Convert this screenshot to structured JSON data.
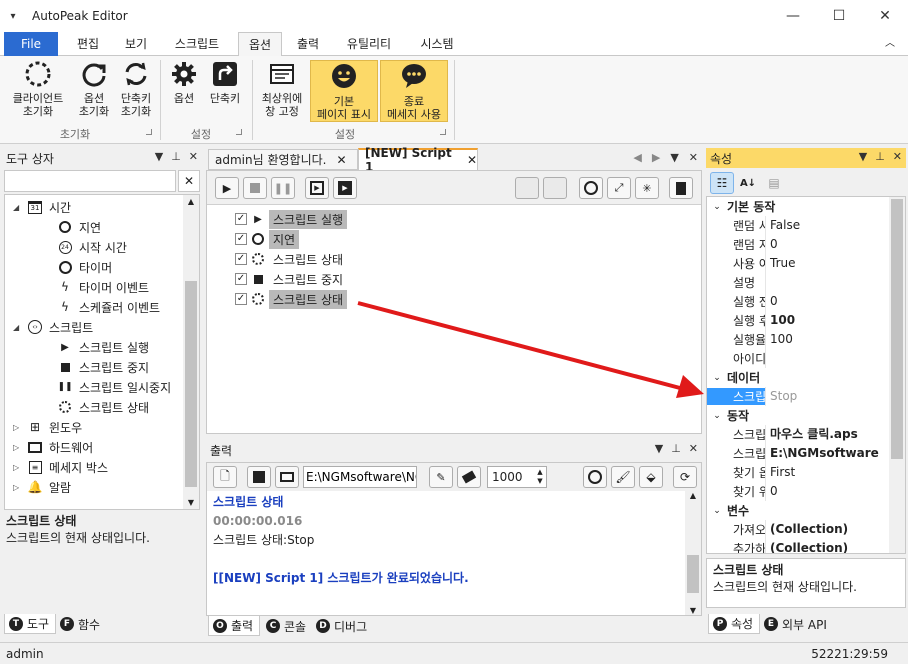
{
  "app": {
    "title": "AutoPeak Editor",
    "qa_icon": "▾"
  },
  "window_controls": {
    "minimize": "—",
    "maximize": "☐",
    "close": "✕"
  },
  "menu": {
    "items": [
      "File",
      "편집",
      "보기",
      "스크립트",
      "옵션",
      "출력",
      "유틸리티",
      "시스템"
    ],
    "active_index": 4,
    "collapse_icon": "chevron-up-icon"
  },
  "ribbon": {
    "buttons": [
      {
        "label": "클라이언트\n초기화",
        "icon": "dotted-circle-icon"
      },
      {
        "label": "옵션\n초기화",
        "icon": "refresh-icon"
      },
      {
        "label": "단축키\n초기화",
        "icon": "refresh-double-icon"
      },
      {
        "label": "옵션",
        "icon": "gear-icon"
      },
      {
        "label": "단축키",
        "icon": "shortcut-icon"
      },
      {
        "label": "최상위에\n창 고정",
        "icon": "window-icon"
      },
      {
        "label": "기본\n페이지 표시",
        "icon": "smiley-icon"
      },
      {
        "label": "종료\n메세지 사용",
        "icon": "chat-icon"
      }
    ],
    "groups": [
      "초기화",
      "설정",
      "설정"
    ]
  },
  "toolbox": {
    "title": "도구 상자",
    "search_value": "",
    "clear_icon": "✕",
    "tree": [
      {
        "label": "시간",
        "level": 0,
        "expander": "◢",
        "icon": "calendar-icon"
      },
      {
        "label": "지연",
        "level": 1,
        "icon": "stopwatch-icon"
      },
      {
        "label": "시작 시간",
        "level": 1,
        "icon": "clock24-icon"
      },
      {
        "label": "타이머",
        "level": 1,
        "icon": "alarm-icon"
      },
      {
        "label": "타이머 이벤트",
        "level": 1,
        "icon": "lightning-icon"
      },
      {
        "label": "스케쥴러 이벤트",
        "level": 1,
        "icon": "lightning-icon"
      },
      {
        "label": "스크립트",
        "level": 0,
        "expander": "◢",
        "icon": "code-icon"
      },
      {
        "label": "스크립트 실행",
        "level": 1,
        "icon": "play-icon"
      },
      {
        "label": "스크립트 중지",
        "level": 1,
        "icon": "stop-icon"
      },
      {
        "label": "스크립트 일시중지",
        "level": 1,
        "icon": "pause-icon"
      },
      {
        "label": "스크립트 상태",
        "level": 1,
        "icon": "dotted-circle-icon"
      },
      {
        "label": "윈도우",
        "level": 0,
        "expander": "▷",
        "icon": "windows-icon"
      },
      {
        "label": "하드웨어",
        "level": 0,
        "expander": "▷",
        "icon": "monitor-icon"
      },
      {
        "label": "메세지 박스",
        "level": 0,
        "expander": "▷",
        "icon": "message-box-icon"
      },
      {
        "label": "알람",
        "level": 0,
        "expander": "▷",
        "icon": "bell-icon"
      }
    ],
    "desc_title": "스크립트 상태",
    "desc_text": "스크립트의 현재 상태입니다.",
    "tabs": [
      {
        "badge": "T",
        "label": "도구"
      },
      {
        "badge": "F",
        "label": "함수"
      }
    ]
  },
  "editor": {
    "tabs": [
      {
        "label": "admin님 환영합니다.",
        "active": false
      },
      {
        "label": "[NEW] Script 1",
        "active": true
      }
    ],
    "steps": [
      {
        "label": "스크립트 실행",
        "checked": true,
        "icon": "play-icon",
        "highlight": true
      },
      {
        "label": "지연",
        "checked": true,
        "icon": "stopwatch-icon",
        "highlight": true
      },
      {
        "label": "스크립트 상태",
        "checked": true,
        "icon": "dotted-circle-icon",
        "highlight": false
      },
      {
        "label": "스크립트 중지",
        "checked": true,
        "icon": "stop-icon",
        "highlight": false
      },
      {
        "label": "스크립트 상태",
        "checked": true,
        "icon": "dotted-circle-icon",
        "highlight": true
      }
    ]
  },
  "output": {
    "title": "출력",
    "path_value": "E:\\NGMsoftware\\NG",
    "count_value": "1000",
    "lines": [
      {
        "text": "스크립트 상태",
        "color": "#1a3fbf",
        "bold": true
      },
      {
        "text": "00:00:00.016",
        "color": "#8a8a8a",
        "bold": true
      },
      {
        "text": "스크립트 상태:Stop",
        "color": "#222222",
        "bold": false
      },
      {
        "text": "",
        "color": "#222222",
        "bold": false
      },
      {
        "text": "[[NEW] Script 1] 스크립트가 완료되었습니다.",
        "color": "#1a3fbf",
        "bold": true
      }
    ],
    "tabs": [
      {
        "badge": "O",
        "label": "출력"
      },
      {
        "badge": "C",
        "label": "콘솔"
      },
      {
        "badge": "D",
        "label": "디버그"
      }
    ]
  },
  "properties": {
    "title": "속성",
    "categories": [
      {
        "name": "기본 동작",
        "rows": [
          {
            "k": "랜덤 사용",
            "v": "False",
            "bold": false
          },
          {
            "k": "랜덤 지연",
            "v": "0",
            "bold": false
          },
          {
            "k": "사용 여부",
            "v": "True",
            "bold": false
          },
          {
            "k": "설명",
            "v": "",
            "bold": false
          },
          {
            "k": "실행 전 지",
            "v": "0",
            "bold": false
          },
          {
            "k": "실행 후 지",
            "v": "100",
            "bold": true
          },
          {
            "k": "실행율",
            "v": "100",
            "bold": false
          },
          {
            "k": "아이디",
            "v": "",
            "bold": false
          }
        ]
      },
      {
        "name": "데이터",
        "rows": [
          {
            "k": "스크립트",
            "v": "Stop",
            "bold": false,
            "selected": true
          }
        ]
      },
      {
        "name": "동작",
        "rows": [
          {
            "k": "스크립트",
            "v": "마우스 클릭.aps",
            "bold": true
          },
          {
            "k": "스크립트",
            "v": "E:\\NGMsoftware",
            "bold": true
          },
          {
            "k": "찾기 옵션",
            "v": "First",
            "bold": false
          },
          {
            "k": "찾기 위치",
            "v": "0",
            "bold": false
          }
        ]
      },
      {
        "name": "변수",
        "rows": [
          {
            "k": "가져오기",
            "v": "(Collection)",
            "bold": true
          },
          {
            "k": "추가하기",
            "v": "(Collection)",
            "bold": true
          }
        ]
      }
    ],
    "desc_title": "스크립트 상태",
    "desc_text": "스크립트의 현재 상태입니다.",
    "tabs": [
      {
        "badge": "P",
        "label": "속성"
      },
      {
        "badge": "E",
        "label": "외부 API"
      }
    ]
  },
  "statusbar": {
    "user": "admin",
    "time": "52221:29:59"
  },
  "colors": {
    "accent": "#2b6bd1",
    "highlight": "#fcd968",
    "arrow": "#e01a1a",
    "selection": "#3399ff"
  }
}
